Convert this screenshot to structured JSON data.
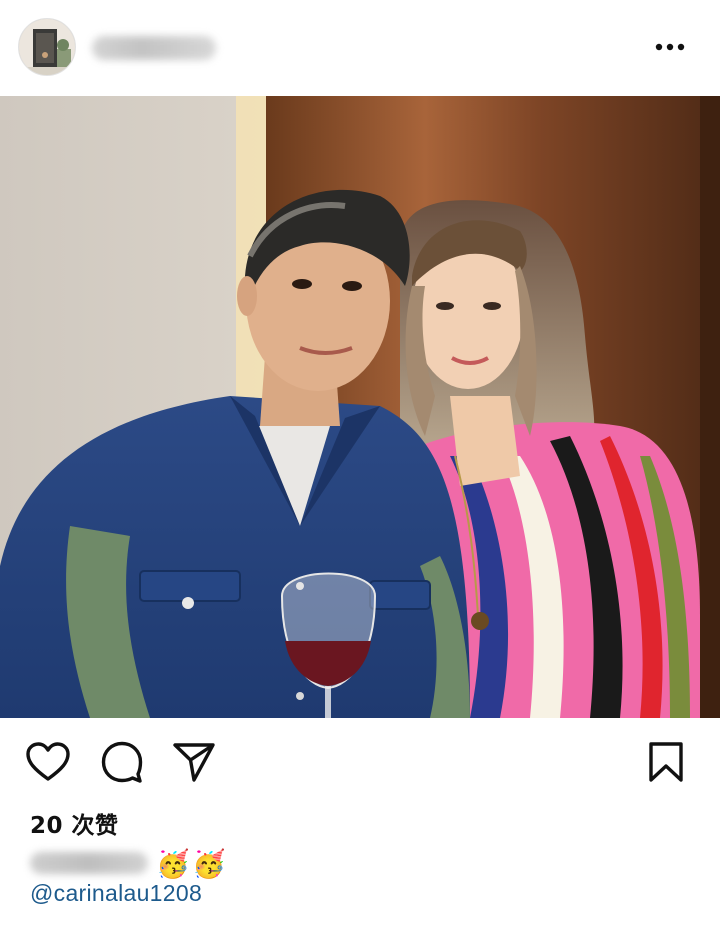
{
  "post": {
    "likes_text": "20 次赞",
    "caption_emojis": [
      "🥳",
      "🥳"
    ],
    "mention": "@carinalau1208"
  },
  "icons": {
    "more": "more-options-icon",
    "like": "heart-icon",
    "comment": "comment-icon",
    "share": "send-icon",
    "save": "bookmark-icon"
  },
  "colors": {
    "mention": "#1d5a8c",
    "text": "#111111"
  }
}
